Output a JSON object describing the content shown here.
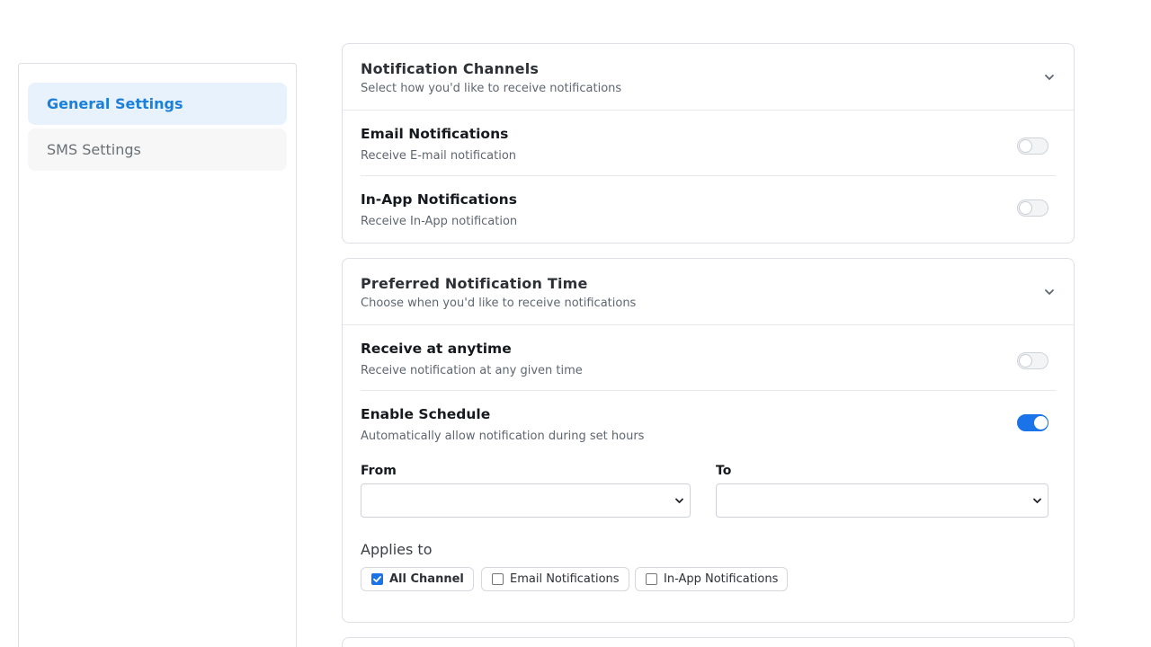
{
  "sidebar": {
    "items": [
      {
        "label": "General Settings",
        "active": true
      },
      {
        "label": "SMS Settings",
        "active": false
      }
    ]
  },
  "channels_card": {
    "title": "Notification Channels",
    "subtitle": "Select how you'd like to receive notifications",
    "rows": [
      {
        "title": "Email Notifications",
        "subtitle": "Receive E-mail notification",
        "enabled": false
      },
      {
        "title": "In-App Notifications",
        "subtitle": "Receive In-App notification",
        "enabled": false
      }
    ]
  },
  "time_card": {
    "title": "Preferred Notification Time",
    "subtitle": "Choose when you'd like to receive notifications",
    "rows": [
      {
        "title": "Receive at anytime",
        "subtitle": "Receive notification at any given time",
        "enabled": false
      },
      {
        "title": "Enable Schedule",
        "subtitle": "Automatically allow notification during set hours",
        "enabled": true
      }
    ],
    "from_label": "From",
    "to_label": "To",
    "from_value": "",
    "to_value": "",
    "applies_label": "Applies to",
    "applies_options": [
      {
        "label": "All Channel",
        "checked": true
      },
      {
        "label": "Email Notifications",
        "checked": false
      },
      {
        "label": "In-App Notifications",
        "checked": false
      }
    ]
  },
  "colors": {
    "accent": "#1a73e8",
    "active_nav_bg": "#e8f2fc",
    "active_nav_text": "#1b7fdc"
  },
  "icons": {
    "chevron": "chevron-down-icon",
    "checkmark": "checkmark-icon"
  }
}
